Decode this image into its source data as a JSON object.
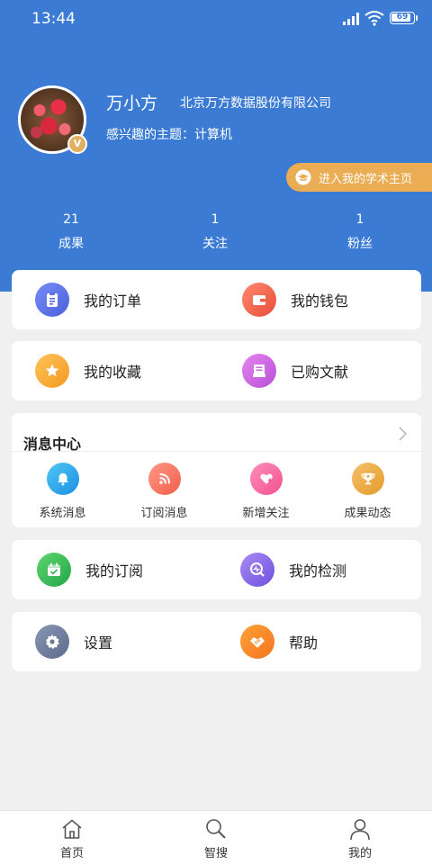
{
  "status_bar": {
    "time": "13:44",
    "battery": "69"
  },
  "profile": {
    "name": "万小方",
    "organization": "北京万方数据股份有限公司",
    "interest": "感兴趣的主题：计算机",
    "badge": "V",
    "scholar_button": "进入我的学术主页",
    "stats": [
      {
        "count": "21",
        "label": "成果"
      },
      {
        "count": "1",
        "label": "关注"
      },
      {
        "count": "1",
        "label": "粉丝"
      }
    ]
  },
  "menu": {
    "orders": "我的订单",
    "wallet": "我的钱包",
    "favorites": "我的收藏",
    "purchased": "已购文献",
    "subscriptions": "我的订阅",
    "checks": "我的检测",
    "settings": "设置",
    "help": "帮助"
  },
  "messages": {
    "title": "消息中心",
    "items": [
      "系统消息",
      "订阅消息",
      "新增关注",
      "成果动态"
    ]
  },
  "tabbar": {
    "items": [
      "首页",
      "智搜",
      "我的"
    ]
  },
  "colors": {
    "header": "#3b7bd4",
    "accent_gold": "#eaad54"
  }
}
